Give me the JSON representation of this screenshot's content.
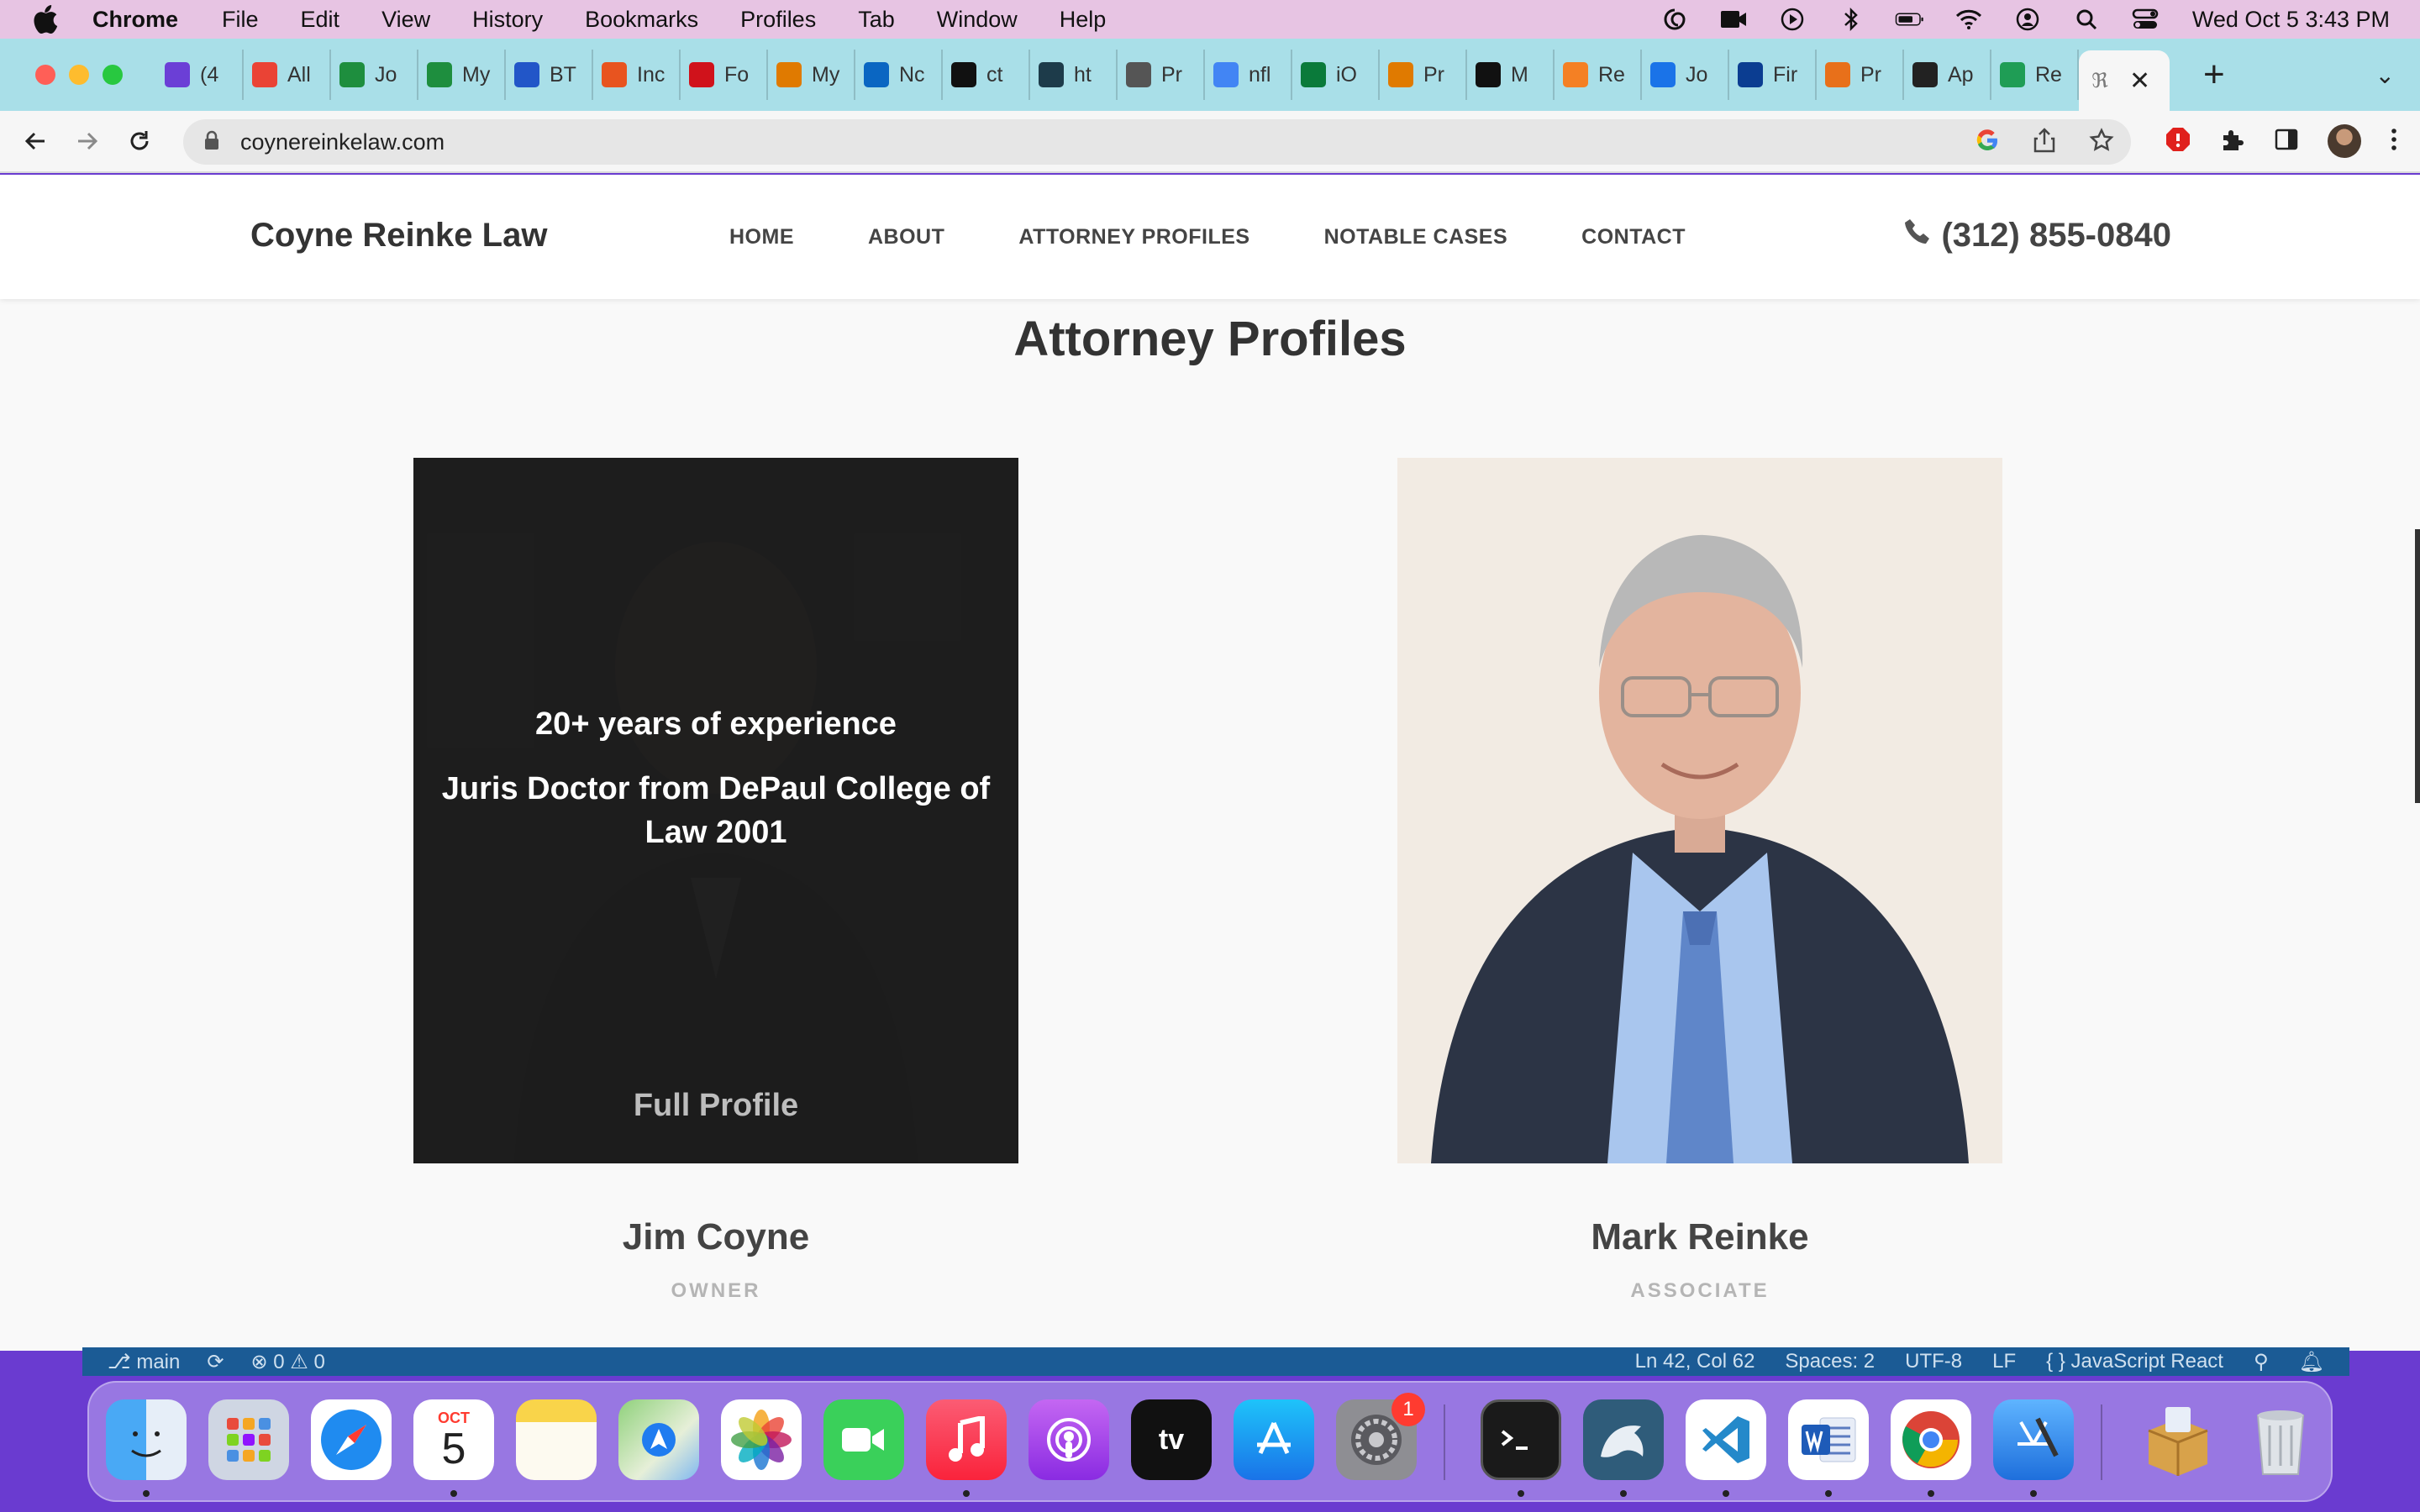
{
  "menubar": {
    "app": "Chrome",
    "items": [
      "File",
      "Edit",
      "View",
      "History",
      "Bookmarks",
      "Profiles",
      "Tab",
      "Window",
      "Help"
    ],
    "clock": "Wed Oct 5  3:43 PM"
  },
  "browser": {
    "tabs": [
      {
        "label": "(4",
        "icon": "mail-icon",
        "color": "#6b3fd6"
      },
      {
        "label": "All",
        "icon": "gmail-icon",
        "color": "#ea4335"
      },
      {
        "label": "Jo",
        "icon": "sheets-icon",
        "color": "#1e8e3e"
      },
      {
        "label": "My",
        "icon": "sheets-icon",
        "color": "#1e8e3e"
      },
      {
        "label": "BT",
        "icon": "dollar-icon",
        "color": "#2256c8"
      },
      {
        "label": "Inc",
        "icon": "nbc-icon",
        "color": "#e8541f"
      },
      {
        "label": "Fo",
        "icon": "b-icon",
        "color": "#d0121b"
      },
      {
        "label": "My",
        "icon": "mb-icon",
        "color": "#e07a00"
      },
      {
        "label": "Nc",
        "icon": "linkedin-icon",
        "color": "#0a66c2"
      },
      {
        "label": "ct",
        "icon": "github-icon",
        "color": "#111111"
      },
      {
        "label": "ht",
        "icon": "react-icon",
        "color": "#1d3b4a"
      },
      {
        "label": "Pr",
        "icon": "globe-icon",
        "color": "#555555"
      },
      {
        "label": "nfl",
        "icon": "google-icon",
        "color": "#4285f4"
      },
      {
        "label": "iO",
        "icon": "chart-icon",
        "color": "#0a7a3a"
      },
      {
        "label": "Pr",
        "icon": "arrow-icon",
        "color": "#e07a00"
      },
      {
        "label": "M",
        "icon": "medium-icon",
        "color": "#111111"
      },
      {
        "label": "Re",
        "icon": "stack-icon",
        "color": "#f48024"
      },
      {
        "label": "Jo",
        "icon": "info-icon",
        "color": "#1a73e8"
      },
      {
        "label": "Fir",
        "icon": "nc-icon",
        "color": "#0b3d91"
      },
      {
        "label": "Pr",
        "icon": "io-icon",
        "color": "#e8701a"
      },
      {
        "label": "Ap",
        "icon": "arc-icon",
        "color": "#222222"
      },
      {
        "label": "Re",
        "icon": "w-icon",
        "color": "#1f9d55"
      }
    ],
    "active_tab": {
      "icon": "cr-logo-icon"
    },
    "url": "coynereinkelaw.com"
  },
  "site": {
    "brand": "Coyne Reinke Law",
    "nav": [
      "HOME",
      "ABOUT",
      "ATTORNEY PROFILES",
      "NOTABLE CASES",
      "CONTACT"
    ],
    "phone": "(312) 855-0840",
    "section_title": "Attorney Profiles",
    "attorneys": [
      {
        "name": "Jim Coyne",
        "role": "OWNER",
        "overlay_line1": "20+ years of experience",
        "overlay_line2": "Juris Doctor from DePaul College of Law 2001",
        "overlay_link": "Full Profile"
      },
      {
        "name": "Mark Reinke",
        "role": "ASSOCIATE"
      }
    ]
  },
  "statusbar": {
    "branch": "main",
    "problems": "0",
    "warnings": "0",
    "position": "Ln 42, Col 62",
    "spaces": "Spaces: 2",
    "encoding": "UTF-8",
    "eol": "LF",
    "language": "JavaScript React"
  },
  "dock": {
    "calendar_month": "OCT",
    "calendar_day": "5",
    "settings_badge": "1",
    "apps": [
      "Finder",
      "Launchpad",
      "Safari",
      "Calendar",
      "Notes",
      "Maps",
      "Photos",
      "FaceTime",
      "Music",
      "Podcasts",
      "TV",
      "App Store",
      "System Preferences",
      "Terminal",
      "MySQL Workbench",
      "Visual Studio Code",
      "Microsoft Word",
      "Google Chrome",
      "Xcode",
      "Archive Utility",
      "Trash"
    ]
  }
}
